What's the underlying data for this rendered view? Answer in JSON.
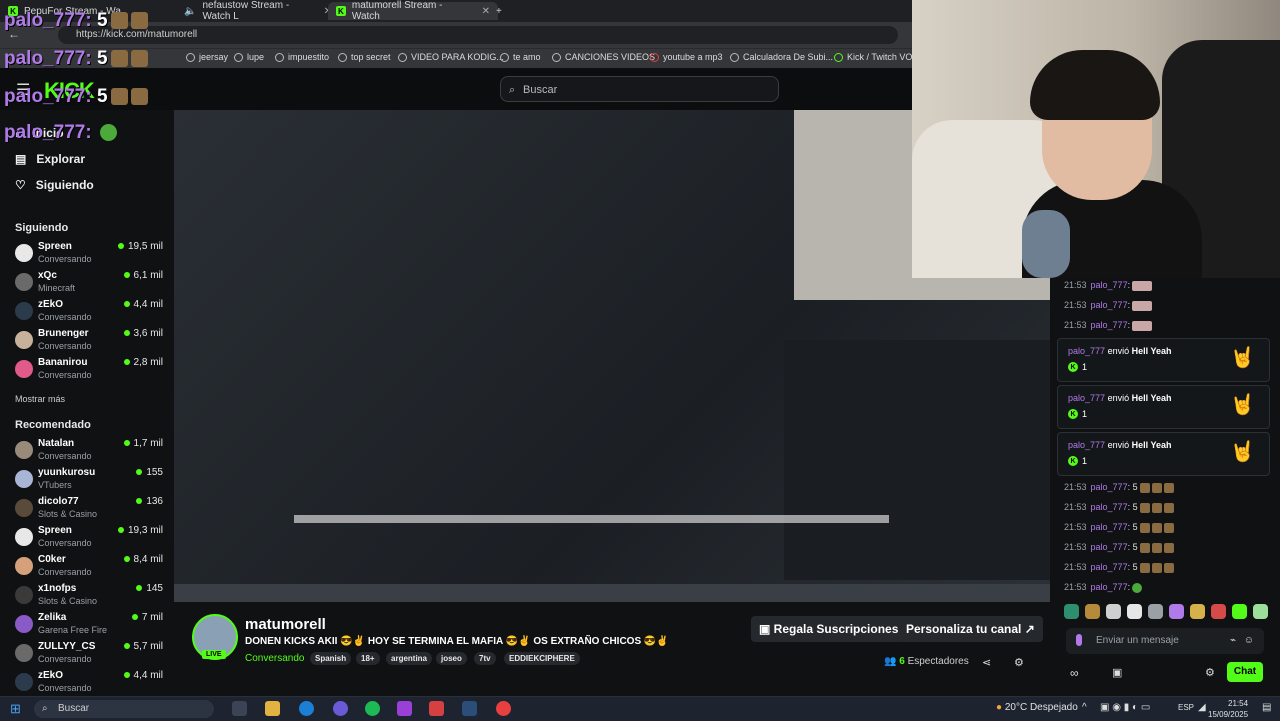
{
  "browser": {
    "tabs": [
      {
        "label": "PepuFor Stream - Wa"
      },
      {
        "label": "nefaustow Stream - Watch L"
      },
      {
        "label": "matumorell Stream - Watch"
      }
    ],
    "url": "https://kick.com/matumorell",
    "bookmarks": [
      "jeersay",
      "lupe",
      "impuestito",
      "top secret",
      "VIDEO PARA KODIG...",
      "te amo",
      "CANCIONES VIDEOS",
      "youtube a mp3",
      "Calculadora De Subi...",
      "Kick / Twitch VOD"
    ]
  },
  "overlay_chat": [
    {
      "user": "palo_777",
      "msg": "5"
    },
    {
      "user": "palo_777",
      "msg": "5"
    },
    {
      "user": "palo_777",
      "msg": "5"
    },
    {
      "user": "palo_777",
      "msg": ""
    }
  ],
  "header": {
    "logo": "KICK",
    "search_placeholder": "Buscar"
  },
  "sidebar": {
    "nav": [
      "Inicio",
      "Explorar",
      "Siguiendo"
    ],
    "following_title": "Siguiendo",
    "following": [
      {
        "name": "Spreen",
        "category": "Conversando",
        "viewers": "19,5 mil"
      },
      {
        "name": "xQc",
        "category": "Minecraft",
        "viewers": "6,1 mil"
      },
      {
        "name": "zEkO",
        "category": "Conversando",
        "viewers": "4,4 mil"
      },
      {
        "name": "Brunenger",
        "category": "Conversando",
        "viewers": "3,6 mil"
      },
      {
        "name": "Bananirou",
        "category": "Conversando",
        "viewers": "2,8 mil"
      }
    ],
    "show_more": "Mostrar más",
    "recommended_title": "Recomendado",
    "recommended": [
      {
        "name": "Natalan",
        "category": "Conversando",
        "viewers": "1,7 mil"
      },
      {
        "name": "yuunkurosu",
        "category": "VTubers",
        "viewers": "155"
      },
      {
        "name": "dicolo77",
        "category": "Slots & Casino",
        "viewers": "136"
      },
      {
        "name": "Spreen",
        "category": "Conversando",
        "viewers": "19,3 mil"
      },
      {
        "name": "C0ker",
        "category": "Conversando",
        "viewers": "8,4 mil"
      },
      {
        "name": "x1nofps",
        "category": "Slots & Casino",
        "viewers": "145"
      },
      {
        "name": "Zelika",
        "category": "Garena Free Fire",
        "viewers": "7 mil"
      },
      {
        "name": "ZULLYY_CS",
        "category": "Conversando",
        "viewers": "5,7 mil"
      },
      {
        "name": "zEkO",
        "category": "Conversando",
        "viewers": "4,4 mil"
      }
    ]
  },
  "chat": {
    "lines_top": [
      {
        "time": "21:53",
        "user": "palo_777",
        "sep": ":"
      },
      {
        "time": "21:53",
        "user": "palo_777",
        "sep": ":"
      },
      {
        "time": "21:53",
        "user": "palo_777",
        "sep": ":"
      }
    ],
    "gifts": [
      {
        "user": "palo_777",
        "verb": "envió",
        "item": "Hell Yeah",
        "count": "1"
      },
      {
        "user": "palo_777",
        "verb": "envió",
        "item": "Hell Yeah",
        "count": "1"
      },
      {
        "user": "palo_777",
        "verb": "envió",
        "item": "Hell Yeah",
        "count": "1"
      }
    ],
    "lines_bottom": [
      {
        "time": "21:53",
        "user": "palo_777",
        "msg": ": 5"
      },
      {
        "time": "21:53",
        "user": "palo_777",
        "msg": ": 5"
      },
      {
        "time": "21:53",
        "user": "palo_777",
        "msg": ": 5"
      },
      {
        "time": "21:53",
        "user": "palo_777",
        "msg": ": 5"
      },
      {
        "time": "21:53",
        "user": "palo_777",
        "msg": ": 5"
      },
      {
        "time": "21:53",
        "user": "palo_777",
        "msg": ":"
      }
    ],
    "input_placeholder": "Enviar un mensaje",
    "send_label": "Chat"
  },
  "stream": {
    "streamer": "matumorell",
    "live_badge": "LIVE",
    "title": "DONEN KICKS AKII 😎✌ HOY SE TERMINA EL MAFIA 😎✌ OS EXTRAÑO CHICOS 😎✌",
    "category": "Conversando",
    "tags": [
      "Spanish",
      "18+",
      "argentina",
      "joseo",
      "7tv",
      "EDDIEKCIPHERE"
    ],
    "gift_button": "Regala Suscripciones",
    "customize_button": "Personaliza tu canal",
    "viewers_count": "6",
    "viewers_label": "Espectadores"
  },
  "taskbar": {
    "search": "Buscar",
    "weather": "20°C  Despejado",
    "lang": "ESP",
    "time": "21:54",
    "date": "15/09/2025"
  },
  "colors": {
    "accent": "#53fc18",
    "username": "#b07be8",
    "bg": "#0b0d0f"
  }
}
